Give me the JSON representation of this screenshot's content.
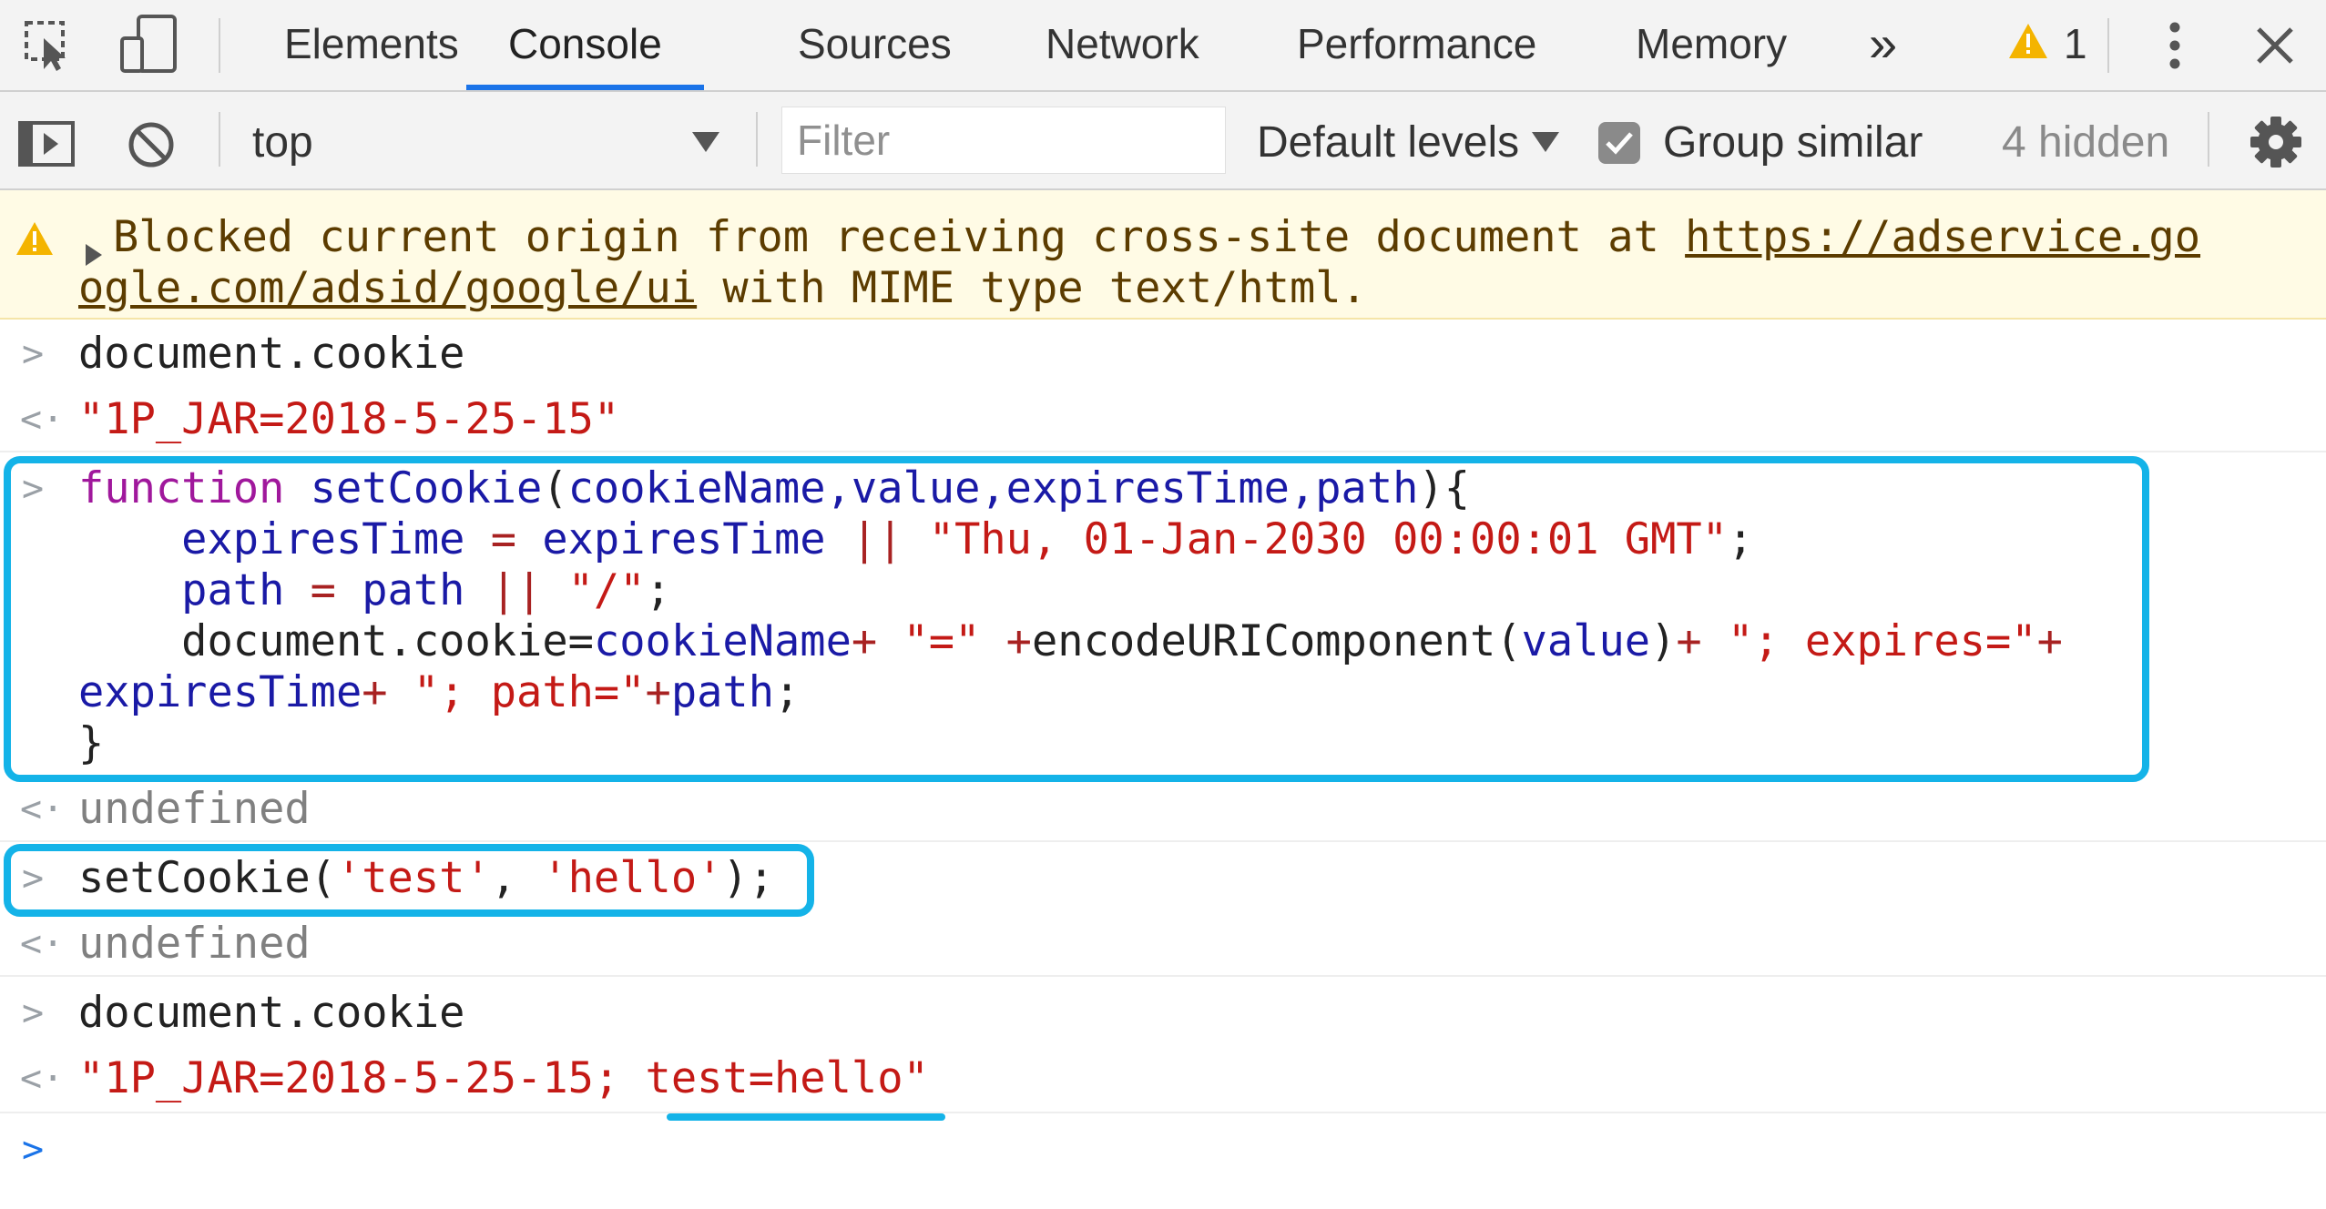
{
  "tabs": {
    "elements": "Elements",
    "console": "Console",
    "sources": "Sources",
    "network": "Network",
    "performance": "Performance",
    "memory": "Memory",
    "more": "»",
    "warning_count": "1"
  },
  "toolbar": {
    "context": "top",
    "filter_placeholder": "Filter",
    "levels": "Default levels",
    "group_similar": "Group similar",
    "group_similar_checked": true,
    "hidden": "4 hidden"
  },
  "console": {
    "warning": {
      "prefix": "Blocked current origin from receiving cross-site document at ",
      "url_part1": "https://adservice.go",
      "url_part2": "ogle.com/adsid/google/ui",
      "suffix": " with MIME type text/html."
    },
    "entries": {
      "input1": "document.cookie",
      "output1": "\"1P_JAR=2018-5-25-15\"",
      "fn_line1": {
        "kw": "function",
        "name": " setCookie",
        "open": "(",
        "params": "cookieName,value,expiresTime,path",
        "close": "){"
      },
      "fn_line2": {
        "lhs": "    expiresTime",
        "eq": " = ",
        "rhs": "expiresTime",
        "or": " || ",
        "str": "\"Thu, 01-Jan-2030 00:00:01 GMT\"",
        "end": ";"
      },
      "fn_line3": {
        "lhs": "    path",
        "eq": " = ",
        "rhs": "path",
        "or": " || ",
        "str": "\"/\"",
        "end": ";"
      },
      "fn_line4": {
        "a": "    document.cookie=",
        "b": "cookieName",
        "c": "+ ",
        "d": "\"=\"",
        "e": " +",
        "f": "encodeURIComponent(",
        "g": "value",
        "h": ")",
        "i": "+ ",
        "j": "\"; expires=\"",
        "k": "+"
      },
      "fn_line5": {
        "a": "expiresTime",
        "b": "+ ",
        "c": "\"; path=\"",
        "d": "+",
        "e": "path",
        "f": ";"
      },
      "fn_line6": "}",
      "output2": "undefined",
      "call": {
        "a": "setCookie(",
        "b": "'test'",
        "c": ", ",
        "d": "'hello'",
        "e": ");"
      },
      "output3": "undefined",
      "input3": "document.cookie",
      "output4": {
        "a": "\"1P_JAR=2018-5-25-15; ",
        "b": "test=hello",
        "c": "\""
      }
    }
  },
  "colors": {
    "highlight": "#14b3e8",
    "active_tab": "#1a73e8",
    "warning_bg": "#fffbe5",
    "warning_icon": "#f4b400"
  }
}
